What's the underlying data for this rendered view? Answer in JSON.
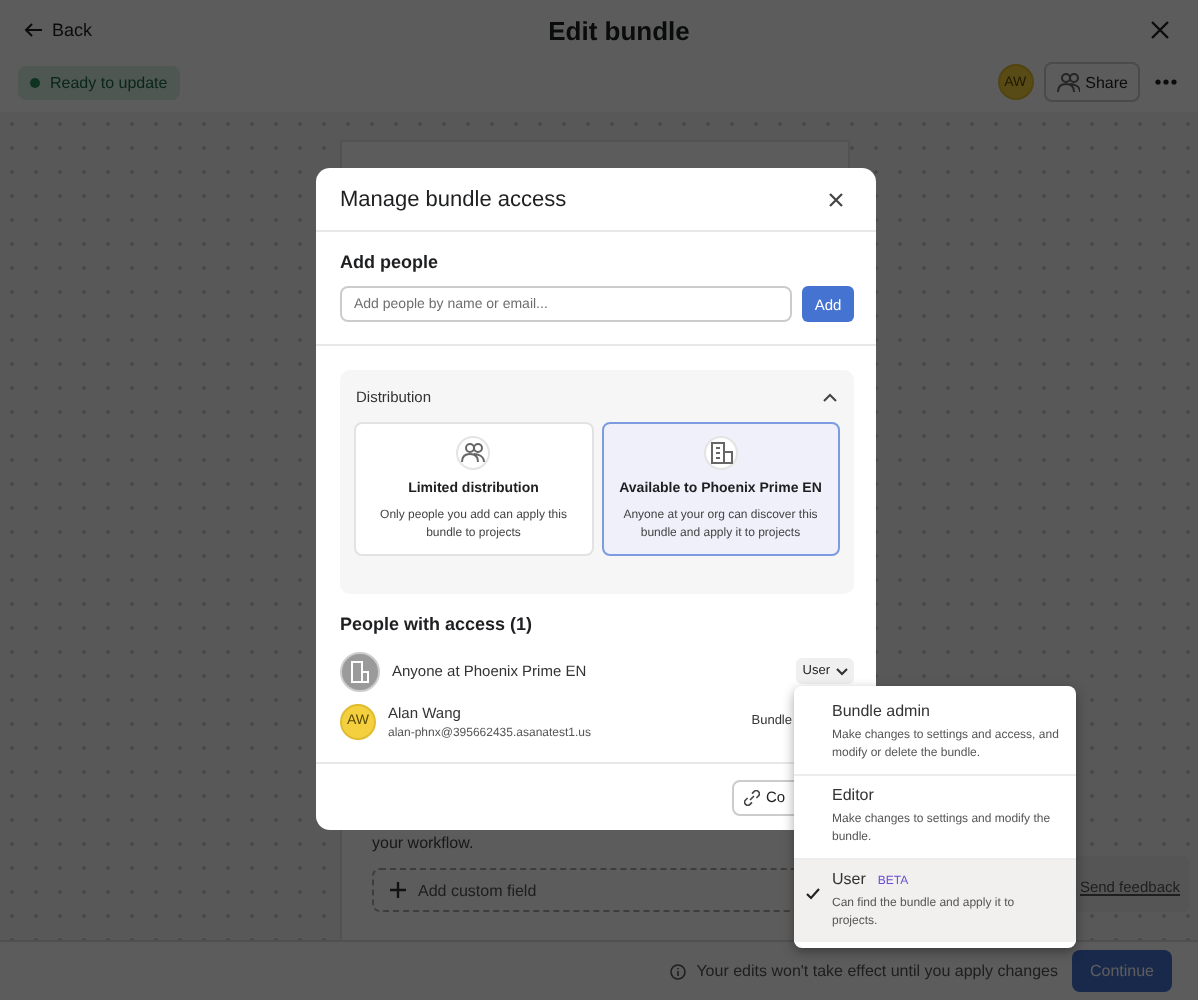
{
  "page": {
    "back": "Back",
    "title": "Edit bundle",
    "status": "Ready to update",
    "avatar": "AW",
    "share": "Share"
  },
  "canvas": {
    "text": "your workflow.",
    "add_field": "Add custom field",
    "feedback": "Send feedback"
  },
  "bottom_bar": {
    "note": "Your edits won't take effect until you apply changes",
    "button": "Continue"
  },
  "dialog": {
    "title": "Manage bundle access",
    "add_people": {
      "label": "Add people",
      "placeholder": "Add people by name or email...",
      "button": "Add"
    },
    "distribution": {
      "title": "Distribution",
      "expanded": true,
      "options": [
        {
          "kind": "people",
          "title": "Limited distribution",
          "description": "Only people you add can apply this bundle to projects",
          "selected": false
        },
        {
          "kind": "org",
          "title": "Available to Phoenix Prime EN",
          "description": "Anyone at your org can discover this bundle and apply it to projects",
          "selected": true
        }
      ]
    },
    "people": {
      "title": "People with access (1)",
      "members": [
        {
          "kind": "org",
          "name": "Anyone at Phoenix Prime EN",
          "role": "User"
        },
        {
          "kind": "person",
          "avatar": "AW",
          "name": "Alan Wang",
          "email": "alan-phnx@395662435.asanatest1.us",
          "role": "Bundle"
        }
      ]
    },
    "footer_button": "Co"
  },
  "role_menu": {
    "items": [
      {
        "title": "Bundle admin",
        "description": "Make changes to settings and access, and modify or delete the bundle.",
        "selected": false
      },
      {
        "title": "Editor",
        "description": "Make changes to settings and modify the bundle.",
        "selected": false
      },
      {
        "title": "User",
        "badge": "BETA",
        "description": "Can find the bundle and apply it to projects.",
        "selected": true
      }
    ]
  }
}
